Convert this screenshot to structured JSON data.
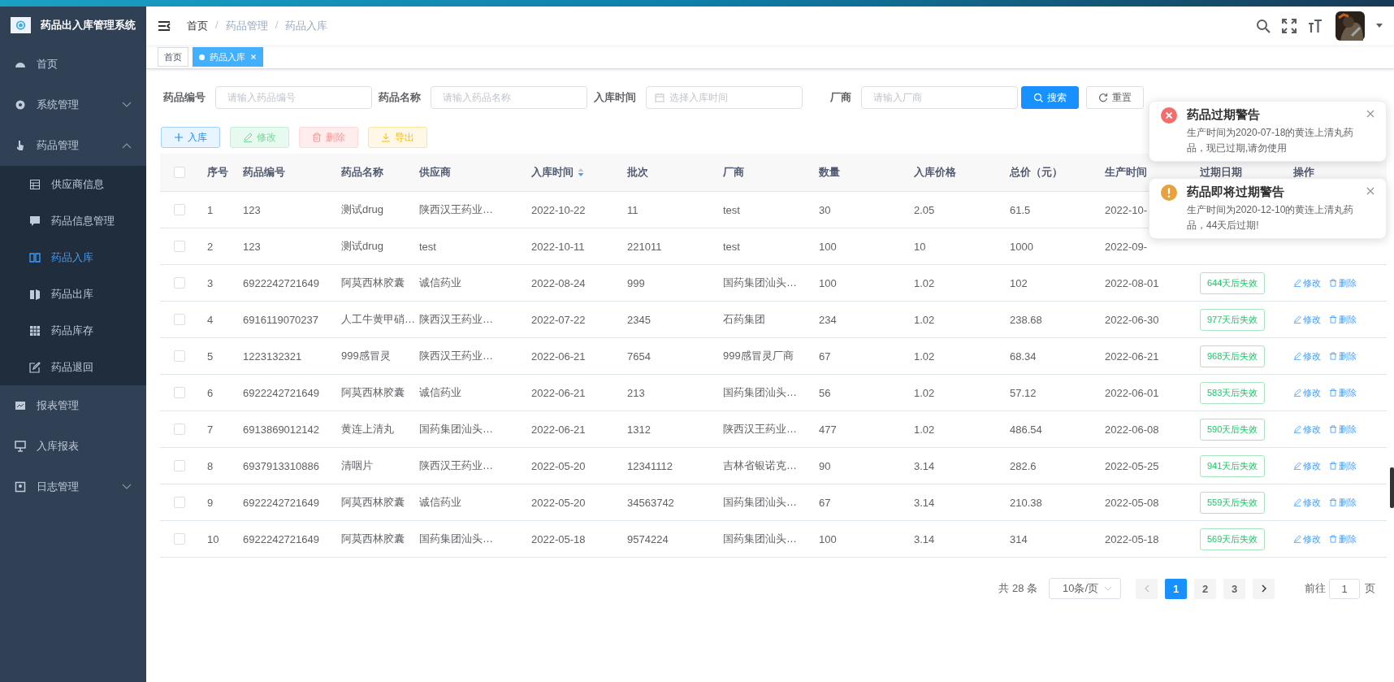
{
  "sidebar": {
    "title": "药品出入库管理系统",
    "items": [
      {
        "label": "首页"
      },
      {
        "label": "系统管理",
        "expanded": false
      },
      {
        "label": "药品管理",
        "expanded": true,
        "children": [
          {
            "label": "供应商信息",
            "selected": false
          },
          {
            "label": "药品信息管理",
            "selected": false
          },
          {
            "label": "药品入库",
            "selected": true
          },
          {
            "label": "药品出库",
            "selected": false
          },
          {
            "label": "药品库存",
            "selected": false
          },
          {
            "label": "药品退回",
            "selected": false
          }
        ]
      },
      {
        "label": "报表管理"
      },
      {
        "label": "入库报表"
      },
      {
        "label": "日志管理",
        "expanded": false
      }
    ]
  },
  "breadcrumb": [
    {
      "label": "首页"
    },
    {
      "separator": "/",
      "label": "药品管理"
    },
    {
      "separator": "/",
      "label": "药品入库"
    }
  ],
  "tags": [
    {
      "label": "首页",
      "selected": false
    },
    {
      "label": "药品入库",
      "selected": true
    }
  ],
  "filters": [
    {
      "label": "药品编号",
      "placeholder": "请输入药品编号",
      "kind": "text"
    },
    {
      "label": "药品名称",
      "placeholder": "请输入药品名称",
      "kind": "text"
    },
    {
      "label": "入库时间",
      "placeholder": "选择入库时间",
      "kind": "date"
    },
    {
      "label": "厂商",
      "placeholder": "请输入厂商",
      "kind": "text"
    }
  ],
  "search_button": "搜索",
  "reset_button": "重置",
  "actions": [
    {
      "label": "入库",
      "kind": "add"
    },
    {
      "label": "修改",
      "kind": "edit"
    },
    {
      "label": "删除",
      "kind": "delete"
    },
    {
      "label": "导出",
      "kind": "export"
    }
  ],
  "table": {
    "all_checked": false,
    "columns": [
      {
        "label": "序号"
      },
      {
        "label": "药品编号"
      },
      {
        "label": "药品名称"
      },
      {
        "label": "供应商"
      },
      {
        "label": "入库时间",
        "sort_descending": true
      },
      {
        "label": "批次"
      },
      {
        "label": "厂商"
      },
      {
        "label": "数量"
      },
      {
        "label": "入库价格"
      },
      {
        "label": "总价（元）"
      },
      {
        "label": "生产时间"
      },
      {
        "label": "过期日期"
      },
      {
        "label": "操作"
      }
    ],
    "rows": [
      {
        "checked": false,
        "cells": [
          "1",
          "123",
          "测试drug",
          "陕西汉王药业…",
          "2022-10-22",
          "11",
          "test",
          "30",
          "2.05",
          "61.5",
          "2022-10-"
        ]
      },
      {
        "checked": false,
        "cells": [
          "2",
          "123",
          "测试drug",
          "test",
          "2022-10-11",
          "221011",
          "test",
          "100",
          "10",
          "1000",
          "2022-09-"
        ]
      },
      {
        "checked": false,
        "cells": [
          "3",
          "6922242721649",
          "阿莫西林胶囊",
          "诚信药业",
          "2022-08-24",
          "999",
          "国药集团汕头…",
          "100",
          "1.02",
          "102",
          "2022-08-01"
        ],
        "expiry": "644天后失效",
        "actions": [
          "修改",
          "删除"
        ]
      },
      {
        "checked": false,
        "cells": [
          "4",
          "6916119070237",
          "人工牛黄甲硝…",
          "陕西汉王药业…",
          "2022-07-22",
          "2345",
          "石药集团",
          "234",
          "1.02",
          "238.68",
          "2022-06-30"
        ],
        "expiry": "977天后失效",
        "actions": [
          "修改",
          "删除"
        ]
      },
      {
        "checked": false,
        "cells": [
          "5",
          "1223132321",
          "999感冒灵",
          "陕西汉王药业…",
          "2022-06-21",
          "7654",
          "999感冒灵厂商",
          "67",
          "1.02",
          "68.34",
          "2022-06-21"
        ],
        "expiry": "968天后失效",
        "actions": [
          "修改",
          "删除"
        ]
      },
      {
        "checked": false,
        "cells": [
          "6",
          "6922242721649",
          "阿莫西林胶囊",
          "诚信药业",
          "2022-06-21",
          "213",
          "国药集团汕头…",
          "56",
          "1.02",
          "57.12",
          "2022-06-01"
        ],
        "expiry": "583天后失效",
        "actions": [
          "修改",
          "删除"
        ]
      },
      {
        "checked": false,
        "cells": [
          "7",
          "6913869012142",
          "黄连上清丸",
          "国药集团汕头…",
          "2022-06-21",
          "1312",
          "陕西汉王药业…",
          "477",
          "1.02",
          "486.54",
          "2022-06-08"
        ],
        "expiry": "590天后失效",
        "actions": [
          "修改",
          "删除"
        ]
      },
      {
        "checked": false,
        "cells": [
          "8",
          "6937913310886",
          "清咽片",
          "陕西汉王药业…",
          "2022-05-20",
          "12341112",
          "吉林省银诺克…",
          "90",
          "3.14",
          "282.6",
          "2022-05-25"
        ],
        "expiry": "941天后失效",
        "actions": [
          "修改",
          "删除"
        ]
      },
      {
        "checked": false,
        "cells": [
          "9",
          "6922242721649",
          "阿莫西林胶囊",
          "诚信药业",
          "2022-05-20",
          "34563742",
          "国药集团汕头…",
          "67",
          "3.14",
          "210.38",
          "2022-05-08"
        ],
        "expiry": "559天后失效",
        "actions": [
          "修改",
          "删除"
        ]
      },
      {
        "checked": false,
        "cells": [
          "10",
          "6922242721649",
          "阿莫西林胶囊",
          "国药集团汕头…",
          "2022-05-18",
          "9574224",
          "国药集团汕头…",
          "100",
          "3.14",
          "314",
          "2022-05-18"
        ],
        "expiry": "569天后失效",
        "actions": [
          "修改",
          "删除"
        ]
      }
    ]
  },
  "pagination": {
    "total": "共 28 条",
    "page_size": "10条/页",
    "prev_disabled": true,
    "pages": [
      {
        "label": "1",
        "selected": true
      },
      {
        "label": "2",
        "selected": false
      },
      {
        "label": "3",
        "selected": false
      }
    ],
    "goto_label": "前往",
    "goto_value": "1",
    "goto_suffix": "页"
  },
  "notifications": [
    {
      "kind": "error",
      "title": "药品过期警告",
      "message": "生产时间为2020-07-18的黄连上清丸药品，现已过期,请勿使用"
    },
    {
      "kind": "warning",
      "title": "药品即将过期警告",
      "message": "生产时间为2020-12-10的黄连上清丸药品，44天后过期!"
    }
  ]
}
